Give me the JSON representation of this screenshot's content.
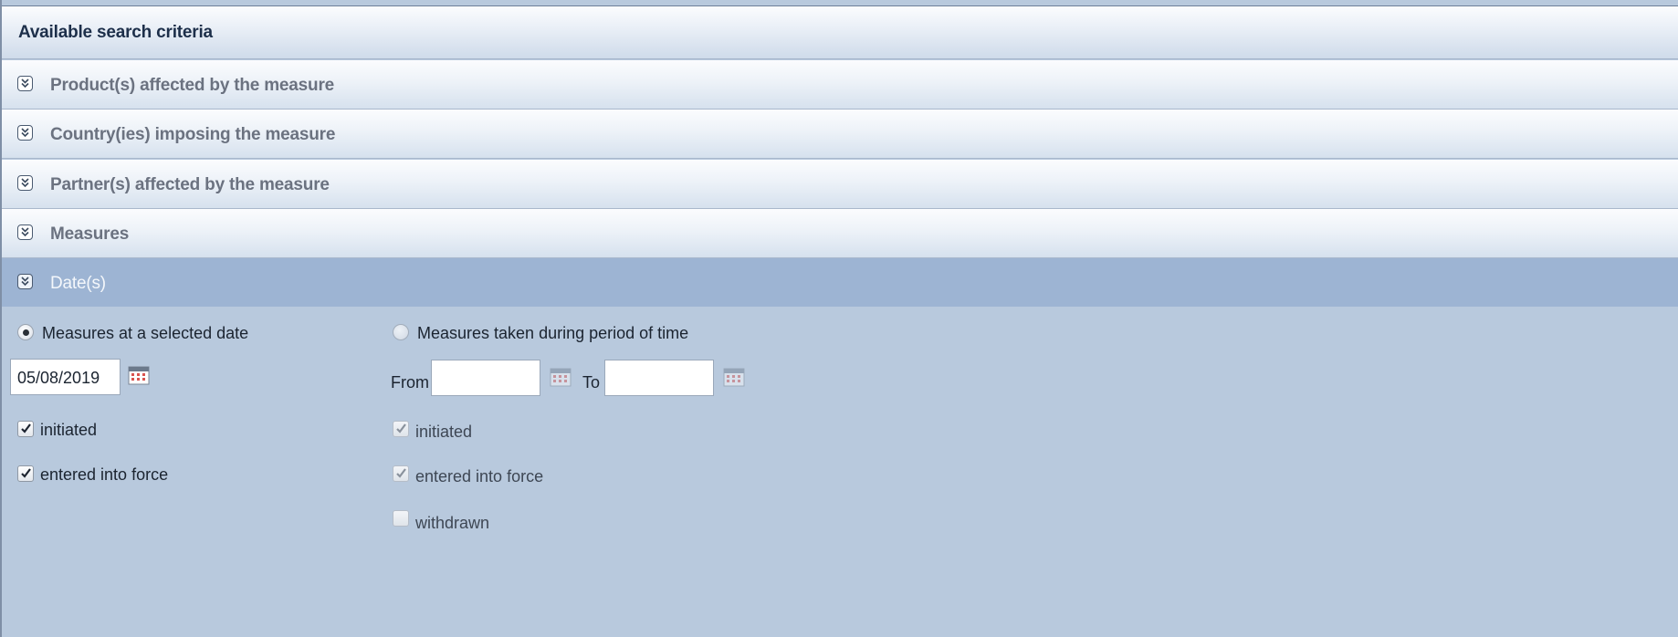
{
  "header": {
    "title": "Available search criteria"
  },
  "sections": [
    {
      "label": "Product(s) affected by the measure",
      "icon": "chevron-double-down-icon"
    },
    {
      "label": "Country(ies) imposing the measure",
      "icon": "chevron-double-down-icon"
    },
    {
      "label": "Partner(s) affected by the measure",
      "icon": "chevron-double-down-icon"
    },
    {
      "label": "Measures",
      "icon": "chevron-double-down-icon"
    },
    {
      "label": "Date(s)",
      "icon": "chevron-double-down-icon",
      "expanded": true
    }
  ],
  "dates": {
    "selected_date": {
      "radio_label": "Measures at a selected date",
      "selected": true,
      "date_value": "05/08/2019",
      "checkboxes": [
        {
          "label": "initiated",
          "checked": true
        },
        {
          "label": "entered into force",
          "checked": true
        }
      ]
    },
    "period": {
      "radio_label": "Measures taken during period of time",
      "selected": false,
      "from_label": "From",
      "from_value": "",
      "to_label": "To",
      "to_value": "",
      "checkboxes": [
        {
          "label": "initiated",
          "checked": true,
          "disabled": true
        },
        {
          "label": "entered into force",
          "checked": true,
          "disabled": true
        },
        {
          "label": "withdrawn",
          "checked": false,
          "disabled": true
        }
      ]
    }
  },
  "colors": {
    "panel_bg": "#b8c9dd",
    "active_section_bg": "#9db4d3",
    "header_text": "#1d2f4a",
    "section_text": "#6b7280"
  }
}
